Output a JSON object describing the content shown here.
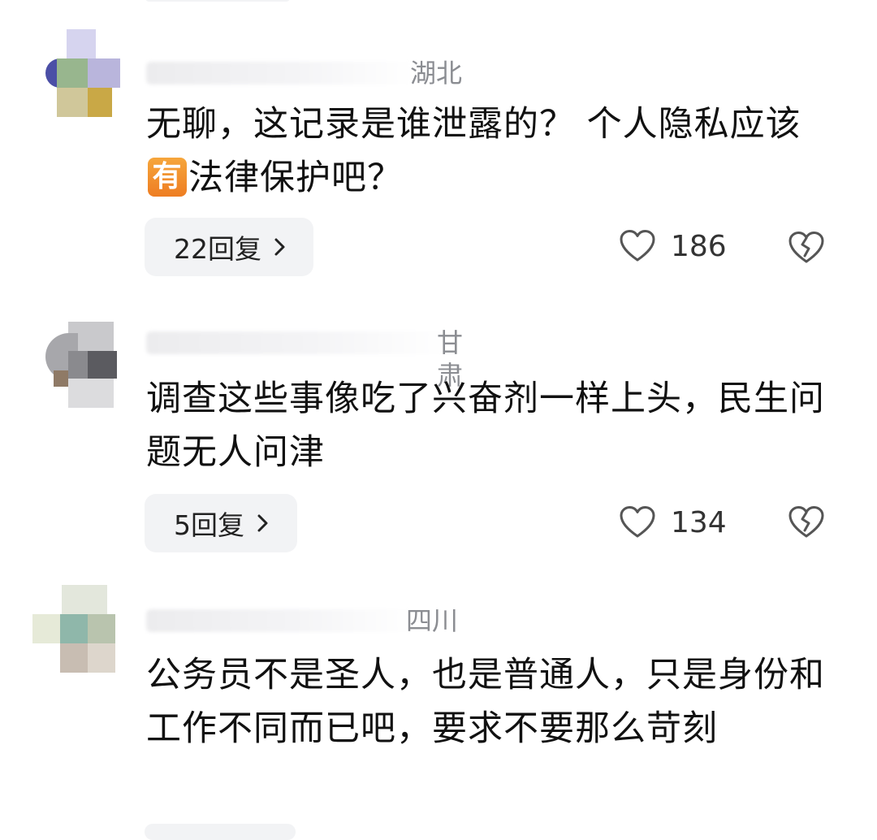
{
  "comments": [
    {
      "location": "湖北",
      "text_before_emoji": "无聊，这记录是谁泄露的？ 个人隐私应该",
      "emoji_char": "有",
      "text_after_emoji": "法律保护吧？",
      "replies_label": "22回复",
      "likes": "186",
      "icons": {
        "like": "heart-outline-icon",
        "dislike": "broken-heart-icon",
        "reply": "chevron-right-icon"
      }
    },
    {
      "location": "甘肃",
      "text": "调查这些事像吃了兴奋剂一样上头，民生问题无人问津",
      "replies_label": "5回复",
      "likes": "134",
      "icons": {
        "like": "heart-outline-icon",
        "dislike": "broken-heart-icon",
        "reply": "chevron-right-icon"
      }
    },
    {
      "location": "四川",
      "text": "公务员不是圣人，也是普通人，只是身份和工作不同而已吧，要求不要那么苛刻"
    }
  ],
  "colors": {
    "text": "#111111",
    "meta": "#8b8d92",
    "button_bg": "#f2f3f5",
    "emoji_orange": "#ee7d22"
  }
}
